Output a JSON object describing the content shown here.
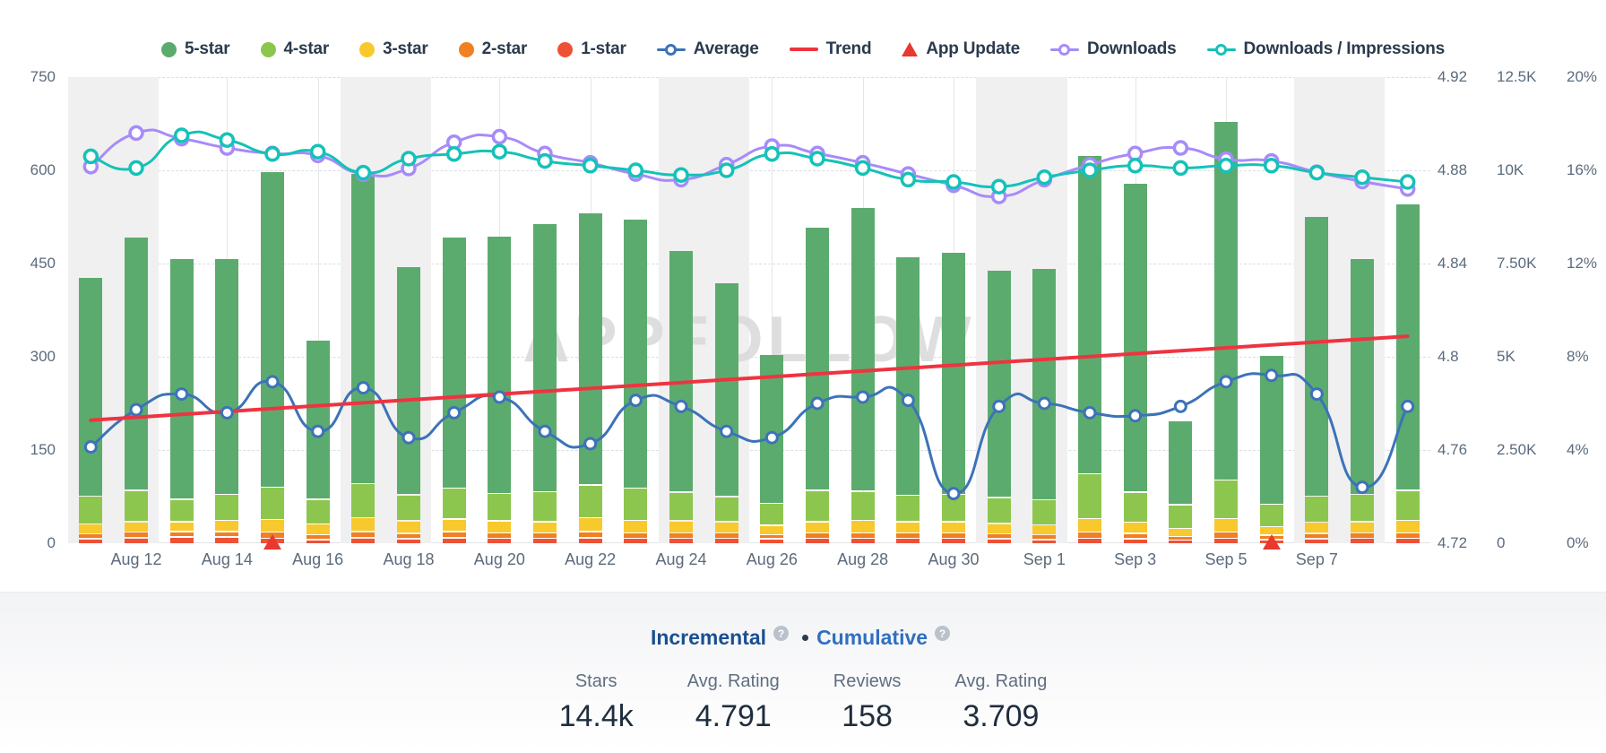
{
  "legend": {
    "items": [
      {
        "label": "5-star",
        "marker": "dot",
        "color": "#5cab6e",
        "name": "legend-item-5-star"
      },
      {
        "label": "4-star",
        "marker": "dot",
        "color": "#8dc64f",
        "name": "legend-item-4-star"
      },
      {
        "label": "3-star",
        "marker": "dot",
        "color": "#f8c92c",
        "name": "legend-item-3-star"
      },
      {
        "label": "2-star",
        "marker": "dot",
        "color": "#f08022",
        "name": "legend-item-2-star"
      },
      {
        "label": "1-star",
        "marker": "dot",
        "color": "#ef5136",
        "name": "legend-item-1-star"
      },
      {
        "label": "Average",
        "marker": "ring-line",
        "color": "#3c73b8",
        "name": "legend-item-average"
      },
      {
        "label": "Trend",
        "marker": "line",
        "color": "#ef3340",
        "name": "legend-item-trend"
      },
      {
        "label": "App Update",
        "marker": "triangle",
        "color": "#e8382f",
        "name": "legend-item-app-update"
      },
      {
        "label": "Downloads",
        "marker": "ring-line",
        "color": "#a78bfa",
        "name": "legend-item-downloads"
      },
      {
        "label": "Downloads / Impressions",
        "marker": "ring-line",
        "color": "#14c2b8",
        "name": "legend-item-downloads-impressions"
      }
    ]
  },
  "watermark": "APPFOLLOW",
  "axes": {
    "left": {
      "ticks": [
        "750",
        "600",
        "450",
        "300",
        "150",
        "0"
      ],
      "values": [
        750,
        600,
        450,
        300,
        150,
        0
      ],
      "min": 0,
      "max": 750
    },
    "right_rating": {
      "ticks": [
        "4.92",
        "4.88",
        "4.84",
        "4.8",
        "4.76",
        "4.72"
      ],
      "values": [
        4.92,
        4.88,
        4.84,
        4.8,
        4.76,
        4.72
      ],
      "min": 4.72,
      "max": 4.92
    },
    "right_downloads": {
      "ticks": [
        "12.5K",
        "10K",
        "7.50K",
        "5K",
        "2.50K",
        "0"
      ],
      "values": [
        12500,
        10000,
        7500,
        5000,
        2500,
        0
      ],
      "min": 0,
      "max": 12500
    },
    "right_percent": {
      "ticks": [
        "20%",
        "16%",
        "12%",
        "8%",
        "4%",
        "0%"
      ],
      "values": [
        20,
        16,
        12,
        8,
        4,
        0
      ],
      "min": 0,
      "max": 20
    }
  },
  "xaxis": {
    "labels": [
      "Aug 12",
      "Aug 14",
      "Aug 16",
      "Aug 18",
      "Aug 20",
      "Aug 22",
      "Aug 24",
      "Aug 26",
      "Aug 28",
      "Aug 30",
      "Sep 1",
      "Sep 3",
      "Sep 5",
      "Sep 7"
    ],
    "label_indices": [
      1,
      3,
      5,
      7,
      9,
      11,
      13,
      15,
      17,
      19,
      21,
      23,
      25,
      27
    ]
  },
  "app_updates": {
    "indices": [
      4,
      26
    ],
    "color": "#e8382f"
  },
  "chart_data": {
    "type": "bar",
    "title": "",
    "xlabel": "",
    "ylabel": "Ratings",
    "ylim": [
      0,
      750
    ],
    "grid": true,
    "legend_position": "top-center",
    "categories": [
      "Aug 11",
      "Aug 12",
      "Aug 13",
      "Aug 14",
      "Aug 15",
      "Aug 16",
      "Aug 17",
      "Aug 18",
      "Aug 19",
      "Aug 20",
      "Aug 21",
      "Aug 22",
      "Aug 23",
      "Aug 24",
      "Aug 25",
      "Aug 26",
      "Aug 27",
      "Aug 28",
      "Aug 29",
      "Aug 30",
      "Aug 31",
      "Sep 1",
      "Sep 2",
      "Sep 3",
      "Sep 4",
      "Sep 5",
      "Sep 6",
      "Sep 7",
      "Sep 8",
      "Sep 9"
    ],
    "weekend_band_indices": [
      0,
      6,
      13,
      20,
      27
    ],
    "stacked_series": [
      {
        "name": "5-star",
        "color": "#5cab6e",
        "values": [
          352,
          408,
          388,
          380,
          508,
          256,
          500,
          368,
          404,
          415,
          432,
          438,
          433,
          390,
          345,
          240,
          424,
          456,
          384,
          390,
          365,
          372,
          512,
          497,
          135,
          577,
          240,
          450,
          380,
          462
        ]
      },
      {
        "name": "4-star",
        "color": "#8dc64f",
        "values": [
          45,
          50,
          36,
          42,
          52,
          40,
          55,
          42,
          50,
          44,
          48,
          53,
          52,
          46,
          40,
          35,
          50,
          47,
          42,
          44,
          42,
          40,
          72,
          48,
          38,
          62,
          36,
          42,
          44,
          48
        ]
      },
      {
        "name": "3-star",
        "color": "#f8c92c",
        "values": [
          16,
          17,
          16,
          18,
          20,
          17,
          22,
          20,
          20,
          19,
          18,
          22,
          20,
          19,
          18,
          15,
          18,
          20,
          18,
          18,
          17,
          16,
          22,
          18,
          13,
          22,
          14,
          18,
          18,
          20
        ]
      },
      {
        "name": "2-star",
        "color": "#f08022",
        "values": [
          8,
          9,
          9,
          9,
          10,
          8,
          10,
          9,
          10,
          9,
          9,
          10,
          9,
          9,
          9,
          7,
          9,
          9,
          9,
          9,
          8,
          8,
          10,
          9,
          6,
          10,
          7,
          9,
          9,
          9
        ]
      },
      {
        "name": "1-star",
        "color": "#ef5136",
        "values": [
          8,
          10,
          11,
          11,
          9,
          7,
          10,
          8,
          10,
          9,
          9,
          10,
          9,
          9,
          9,
          8,
          9,
          9,
          9,
          9,
          8,
          7,
          9,
          8,
          6,
          9,
          7,
          8,
          9,
          9
        ]
      }
    ],
    "line_series": [
      {
        "name": "Average",
        "color": "#3c73b8",
        "axis": "right_rating",
        "marker": "circle",
        "values": [
          4.7613,
          4.7773,
          4.784,
          4.776,
          4.7893,
          4.768,
          4.7867,
          4.7653,
          4.776,
          4.7827,
          4.768,
          4.7627,
          4.7813,
          4.7787,
          4.768,
          4.7653,
          4.78,
          4.7827,
          4.7813,
          4.7413,
          4.7787,
          4.78,
          4.776,
          4.7747,
          4.7787,
          4.7893,
          4.792,
          4.784,
          4.744,
          4.7787
        ]
      },
      {
        "name": "Downloads",
        "color": "#a78bfa",
        "axis": "right_downloads",
        "marker": "ring",
        "values": [
          10100,
          11000,
          10850,
          10600,
          10450,
          10400,
          9900,
          10050,
          10750,
          10900,
          10450,
          10200,
          9900,
          9750,
          10150,
          10650,
          10450,
          10200,
          9900,
          9600,
          9300,
          9750,
          10150,
          10450,
          10600,
          10300,
          10250,
          9950,
          9700,
          9500
        ]
      },
      {
        "name": "Downloads / Impressions",
        "color": "#14c2b8",
        "axis": "right_percent",
        "marker": "ring",
        "values": [
          16.6,
          16.1,
          17.5,
          17.3,
          16.7,
          16.8,
          15.9,
          16.5,
          16.7,
          16.8,
          16.4,
          16.2,
          16.0,
          15.8,
          16.0,
          16.7,
          16.5,
          16.1,
          15.6,
          15.5,
          15.3,
          15.7,
          16.0,
          16.2,
          16.1,
          16.2,
          16.2,
          15.9,
          15.7,
          15.5
        ]
      },
      {
        "name": "Trend",
        "color": "#ef3340",
        "axis": "left",
        "marker": "none",
        "values": [
          198,
          203,
          208,
          213,
          218,
          223,
          228,
          233,
          238,
          243,
          248,
          253,
          258,
          263,
          268,
          273,
          278,
          283,
          288,
          293,
          298,
          303,
          308,
          313,
          318,
          323,
          326,
          329,
          331,
          333
        ]
      }
    ]
  },
  "footer": {
    "modes": [
      {
        "label": "Incremental",
        "active": true,
        "help": "?"
      },
      {
        "label": "Cumulative",
        "active": false,
        "help": "?"
      }
    ],
    "separator": "•",
    "stats": [
      {
        "label": "Stars",
        "value": "14.4k"
      },
      {
        "label": "Avg. Rating",
        "value": "4.791"
      },
      {
        "label": "Reviews",
        "value": "158"
      },
      {
        "label": "Avg. Rating",
        "value": "3.709"
      }
    ]
  }
}
